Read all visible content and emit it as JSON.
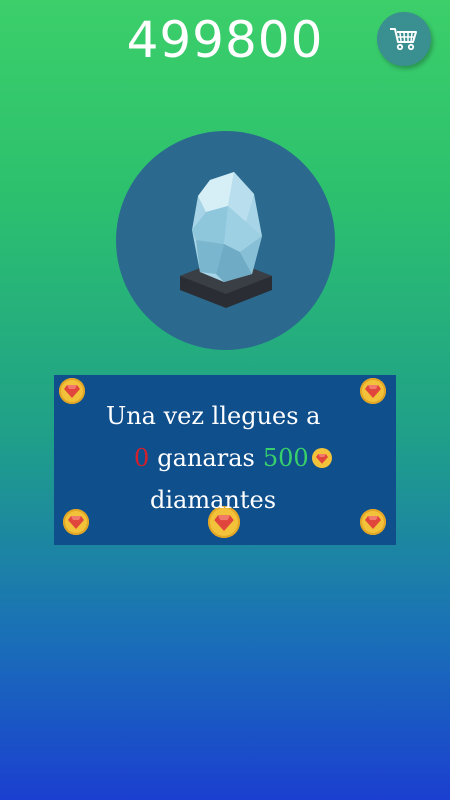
{
  "header": {
    "score": "499800",
    "cart_icon": "shopping-cart-icon"
  },
  "crystal": {
    "icon": "crystal-icon"
  },
  "panel": {
    "line1": "Una vez llegues a",
    "goal_value": "0",
    "ganaras_text": "ganaras",
    "reward_value": "500",
    "line3": "diamantes",
    "coin_icon": "diamond-coin-icon"
  },
  "colors": {
    "goal_value": "#d4202a",
    "reward_value": "#38d06a",
    "panel_background": "#0f4f8c",
    "circle_background": "#2b6a8e"
  }
}
